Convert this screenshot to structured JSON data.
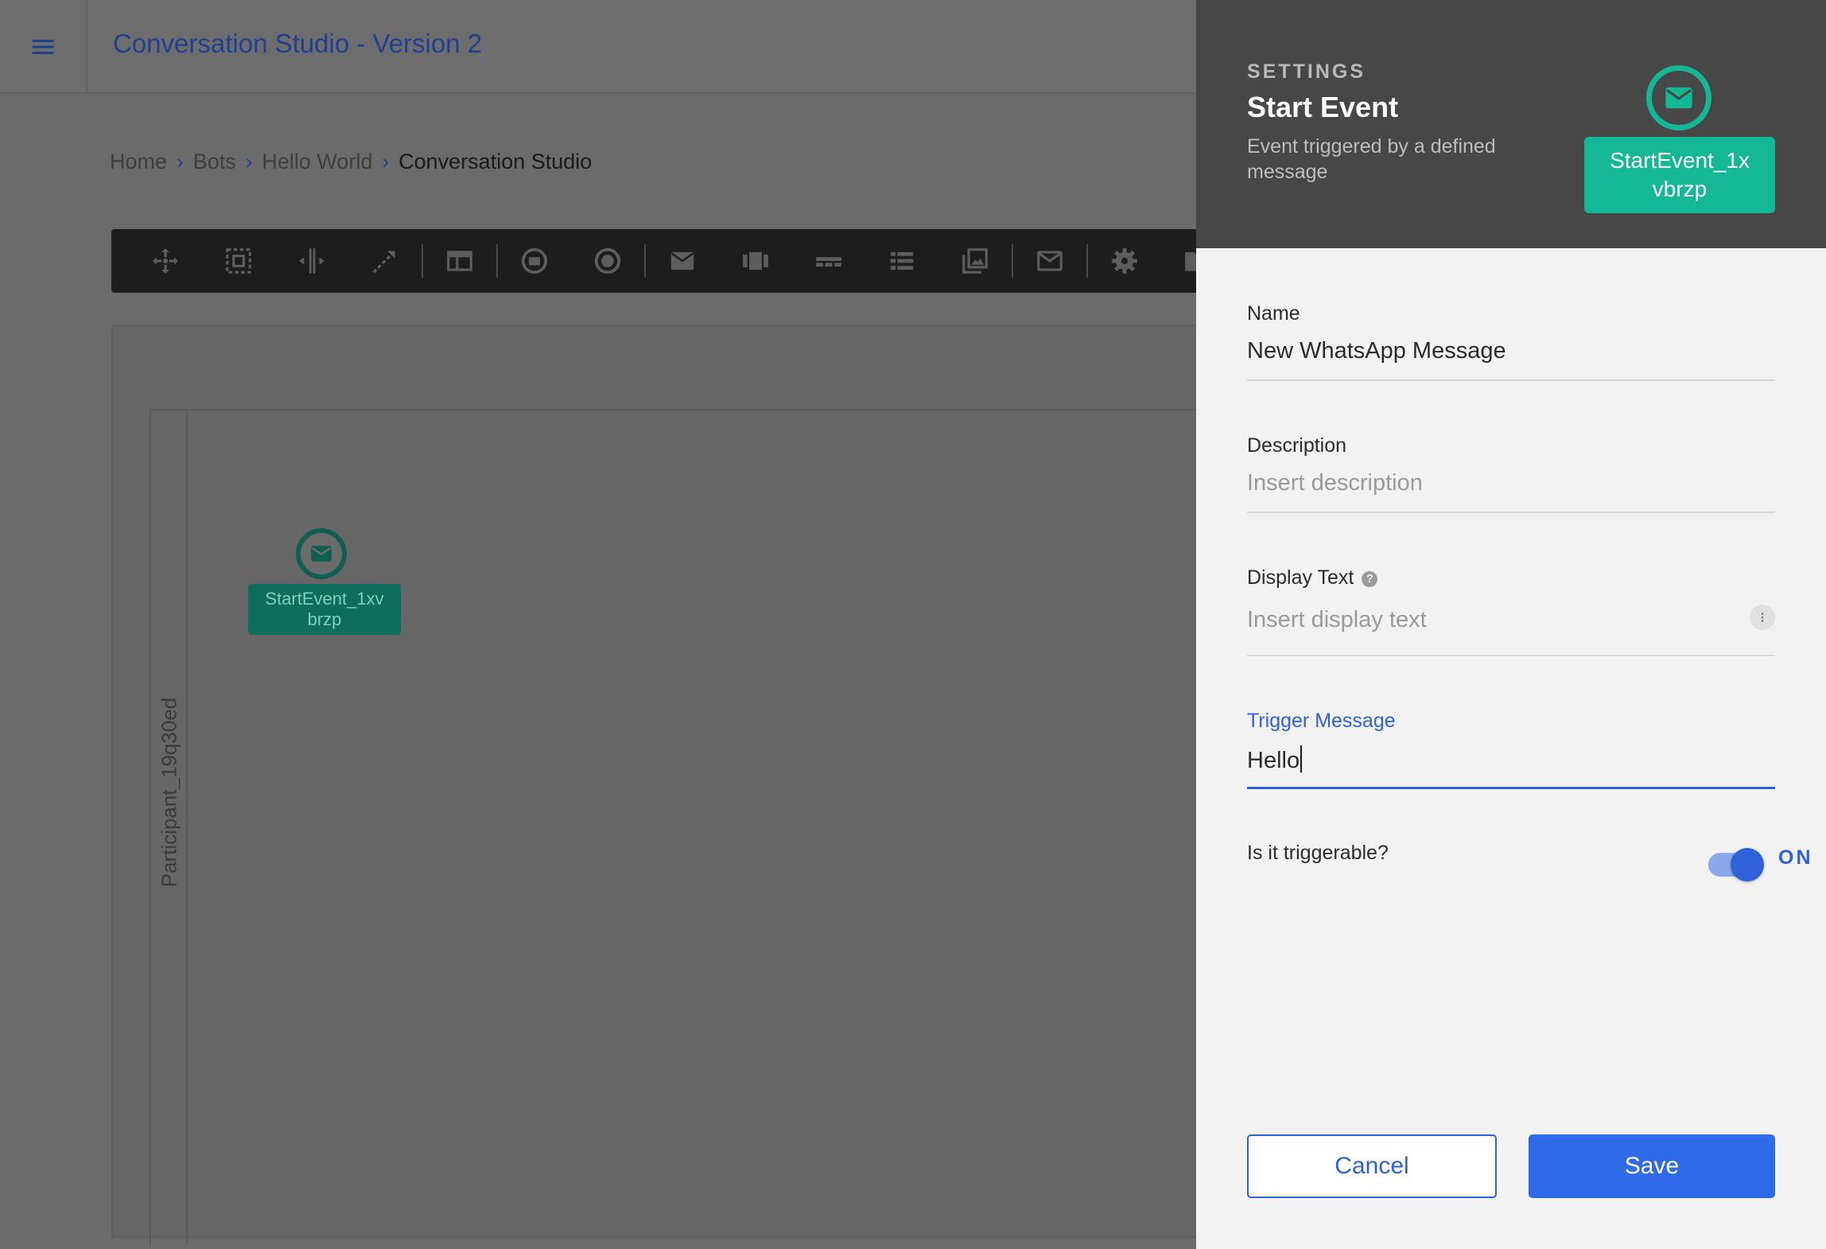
{
  "app": {
    "title": "Conversation Studio - Version 2",
    "breadcrumb": [
      "Home",
      "Bots",
      "Hello World",
      "Conversation Studio"
    ],
    "toolbar": [
      "hand-tool-icon",
      "lasso-tool-icon",
      "space-tool-icon",
      "connect-tool-icon",
      "participant-icon",
      "start-event-icon",
      "timer-event-icon",
      "message-icon",
      "carousel-icon",
      "quick-replies-icon",
      "list-icon",
      "media-icon",
      "email-icon",
      "settings-icon",
      "folder-icon"
    ],
    "canvas": {
      "participant_label": "Participant_19q30ed",
      "event_label_line1": "StartEvent_1xv",
      "event_label_line2": "brzp"
    }
  },
  "drawer": {
    "overline": "SETTINGS",
    "title": "Start Event",
    "subtitle": "Event triggered by a defined message",
    "badge_line1": "StartEvent_1x",
    "badge_line2": "vbrzp",
    "fields": {
      "name": {
        "label": "Name",
        "value": "New WhatsApp Message"
      },
      "description": {
        "label": "Description",
        "placeholder": "Insert description"
      },
      "display_text": {
        "label": "Display Text",
        "placeholder": "Insert display text"
      },
      "trigger_message": {
        "label": "Trigger Message",
        "value": "Hello"
      }
    },
    "triggerable": {
      "label": "Is it triggerable?",
      "state": "ON"
    },
    "buttons": {
      "cancel": "Cancel",
      "save": "Save"
    }
  },
  "colors": {
    "accent": "#2f62d9",
    "teal": "#14b894",
    "drawer_header": "#474747",
    "overlay": "#6b6b6b"
  }
}
